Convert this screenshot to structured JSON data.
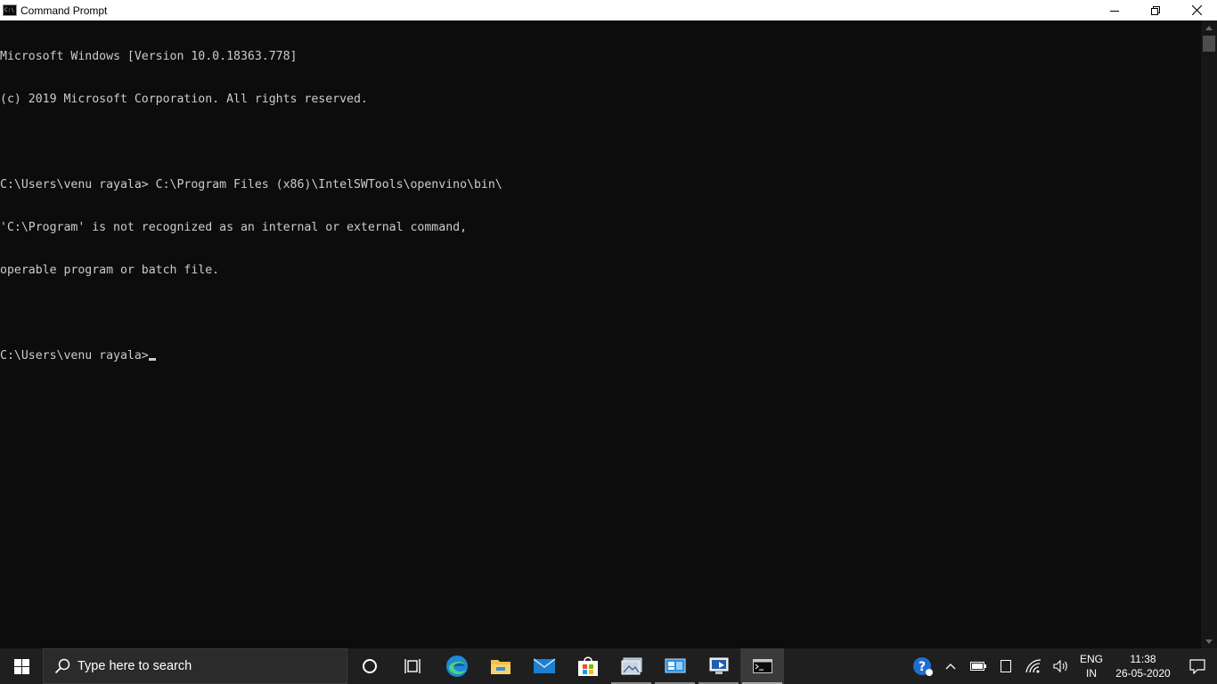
{
  "window": {
    "title": "Command Prompt",
    "icon_text": "C:\\"
  },
  "console": {
    "lines": [
      "Microsoft Windows [Version 10.0.18363.778]",
      "(c) 2019 Microsoft Corporation. All rights reserved.",
      "",
      "C:\\Users\\venu rayala> C:\\Program Files (x86)\\IntelSWTools\\openvino\\bin\\",
      "'C:\\Program' is not recognized as an internal or external command,",
      "operable program or batch file.",
      "",
      "C:\\Users\\venu rayala>"
    ]
  },
  "taskbar": {
    "search_placeholder": "Type here to search",
    "apps": [
      "cortana-icon",
      "task-view-icon",
      "edge-icon",
      "file-explorer-icon",
      "mail-icon",
      "store-icon",
      "photos-app-icon",
      "control-panel-icon",
      "remote-desktop-icon",
      "command-prompt-icon"
    ],
    "active_app": "command-prompt-icon"
  },
  "tray": {
    "lang_line1": "ENG",
    "lang_line2": "IN",
    "time": "11:38",
    "date": "26-05-2020"
  },
  "colors": {
    "console_bg": "#0c0c0c",
    "console_fg": "#cccccc",
    "taskbar_bg": "#1f1f1f",
    "titlebar_bg": "#ffffff"
  }
}
